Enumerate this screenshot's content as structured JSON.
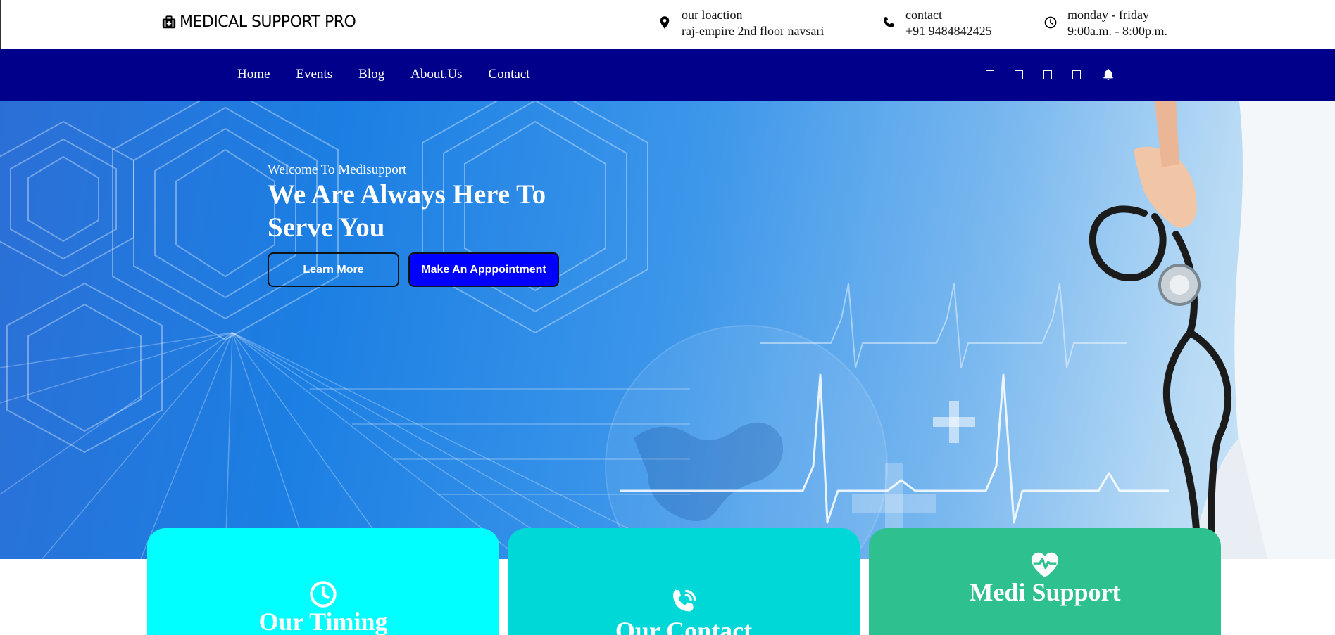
{
  "brand": {
    "name": "MEDICAL SUPPORT PRO",
    "icon": "first-aid-kit-icon"
  },
  "topinfo": {
    "location": {
      "icon": "map-pin-icon",
      "label": "our loaction",
      "value": "raj-empire 2nd floor navsari"
    },
    "contact": {
      "icon": "phone-icon",
      "label": "contact",
      "value": "+91 9484842425"
    },
    "hours": {
      "icon": "clock-icon",
      "label": "monday - friday",
      "value": "9:00a.m. - 8:00p.m."
    }
  },
  "nav": {
    "background": "#00008b",
    "links": [
      "Home",
      "Events",
      "Blog",
      "About.Us",
      "Contact"
    ],
    "icons": [
      "social-icon-1",
      "social-icon-2",
      "social-icon-3",
      "social-icon-4",
      "bell-icon"
    ]
  },
  "hero": {
    "subtitle": "Welcome To Medisupport",
    "title": "We Are Always Here To Serve You",
    "learn_more": "Learn More",
    "appointment": "Make An Apppointment",
    "appointment_color": "#0000ff"
  },
  "cards": [
    {
      "icon": "clock-icon",
      "title": "Our Timing",
      "color": "#00ffff"
    },
    {
      "icon": "phone-call-icon",
      "title": "Our Contact",
      "color": "#00d8d8"
    },
    {
      "icon": "heartbeat-icon",
      "title": "Medi Support",
      "color": "#2ec08e"
    }
  ]
}
